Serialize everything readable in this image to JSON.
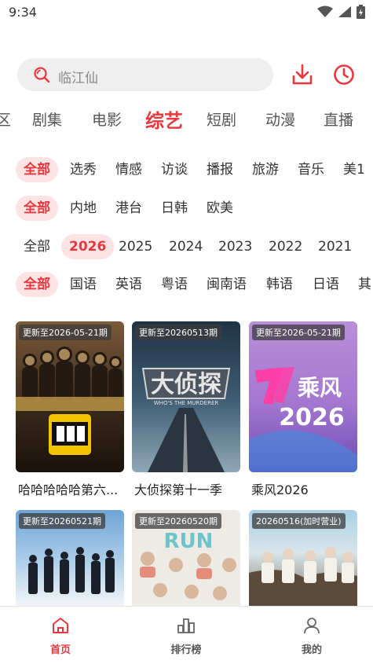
{
  "status": {
    "time": "9:34"
  },
  "search": {
    "placeholder": "临江仙"
  },
  "categories": [
    "区",
    "剧集",
    "电影",
    "综艺",
    "短剧",
    "动漫",
    "直播"
  ],
  "filters": {
    "type": [
      "全部",
      "选秀",
      "情感",
      "访谈",
      "播报",
      "旅游",
      "音乐",
      "美1"
    ],
    "region": [
      "全部",
      "内地",
      "港台",
      "日韩",
      "欧美"
    ],
    "year": [
      "全部",
      "2026",
      "2025",
      "2024",
      "2023",
      "2022",
      "2021"
    ],
    "language": [
      "全部",
      "国语",
      "英语",
      "粤语",
      "闽南语",
      "韩语",
      "日语",
      "其"
    ]
  },
  "cards": [
    {
      "badge": "更新至2026-05-21期",
      "title": "哈哈哈哈哈第六..."
    },
    {
      "badge": "更新至20260513期",
      "title": "大侦探第十一季"
    },
    {
      "badge": "更新至2026-05-21期",
      "title": "乘风2026"
    },
    {
      "badge": "更新至20260521期",
      "title": ""
    },
    {
      "badge": "更新至20260520期",
      "title": ""
    },
    {
      "badge": "20260516(加时营业)",
      "title": ""
    }
  ],
  "poster_text": {
    "c2_logo": "大侦探",
    "c2_sub": "WHO'S THE MURDERER",
    "c3_title": "乘风",
    "c3_year": "2026",
    "c5_logo": "RUN"
  },
  "tabbar": [
    {
      "label": "首页",
      "icon": "home-icon"
    },
    {
      "label": "排行榜",
      "icon": "chart-icon"
    },
    {
      "label": "我的",
      "icon": "user-icon"
    }
  ],
  "colors": {
    "accent": "#e8383d",
    "chip_bg": "#fde3e4",
    "search_bg": "#efefef"
  }
}
